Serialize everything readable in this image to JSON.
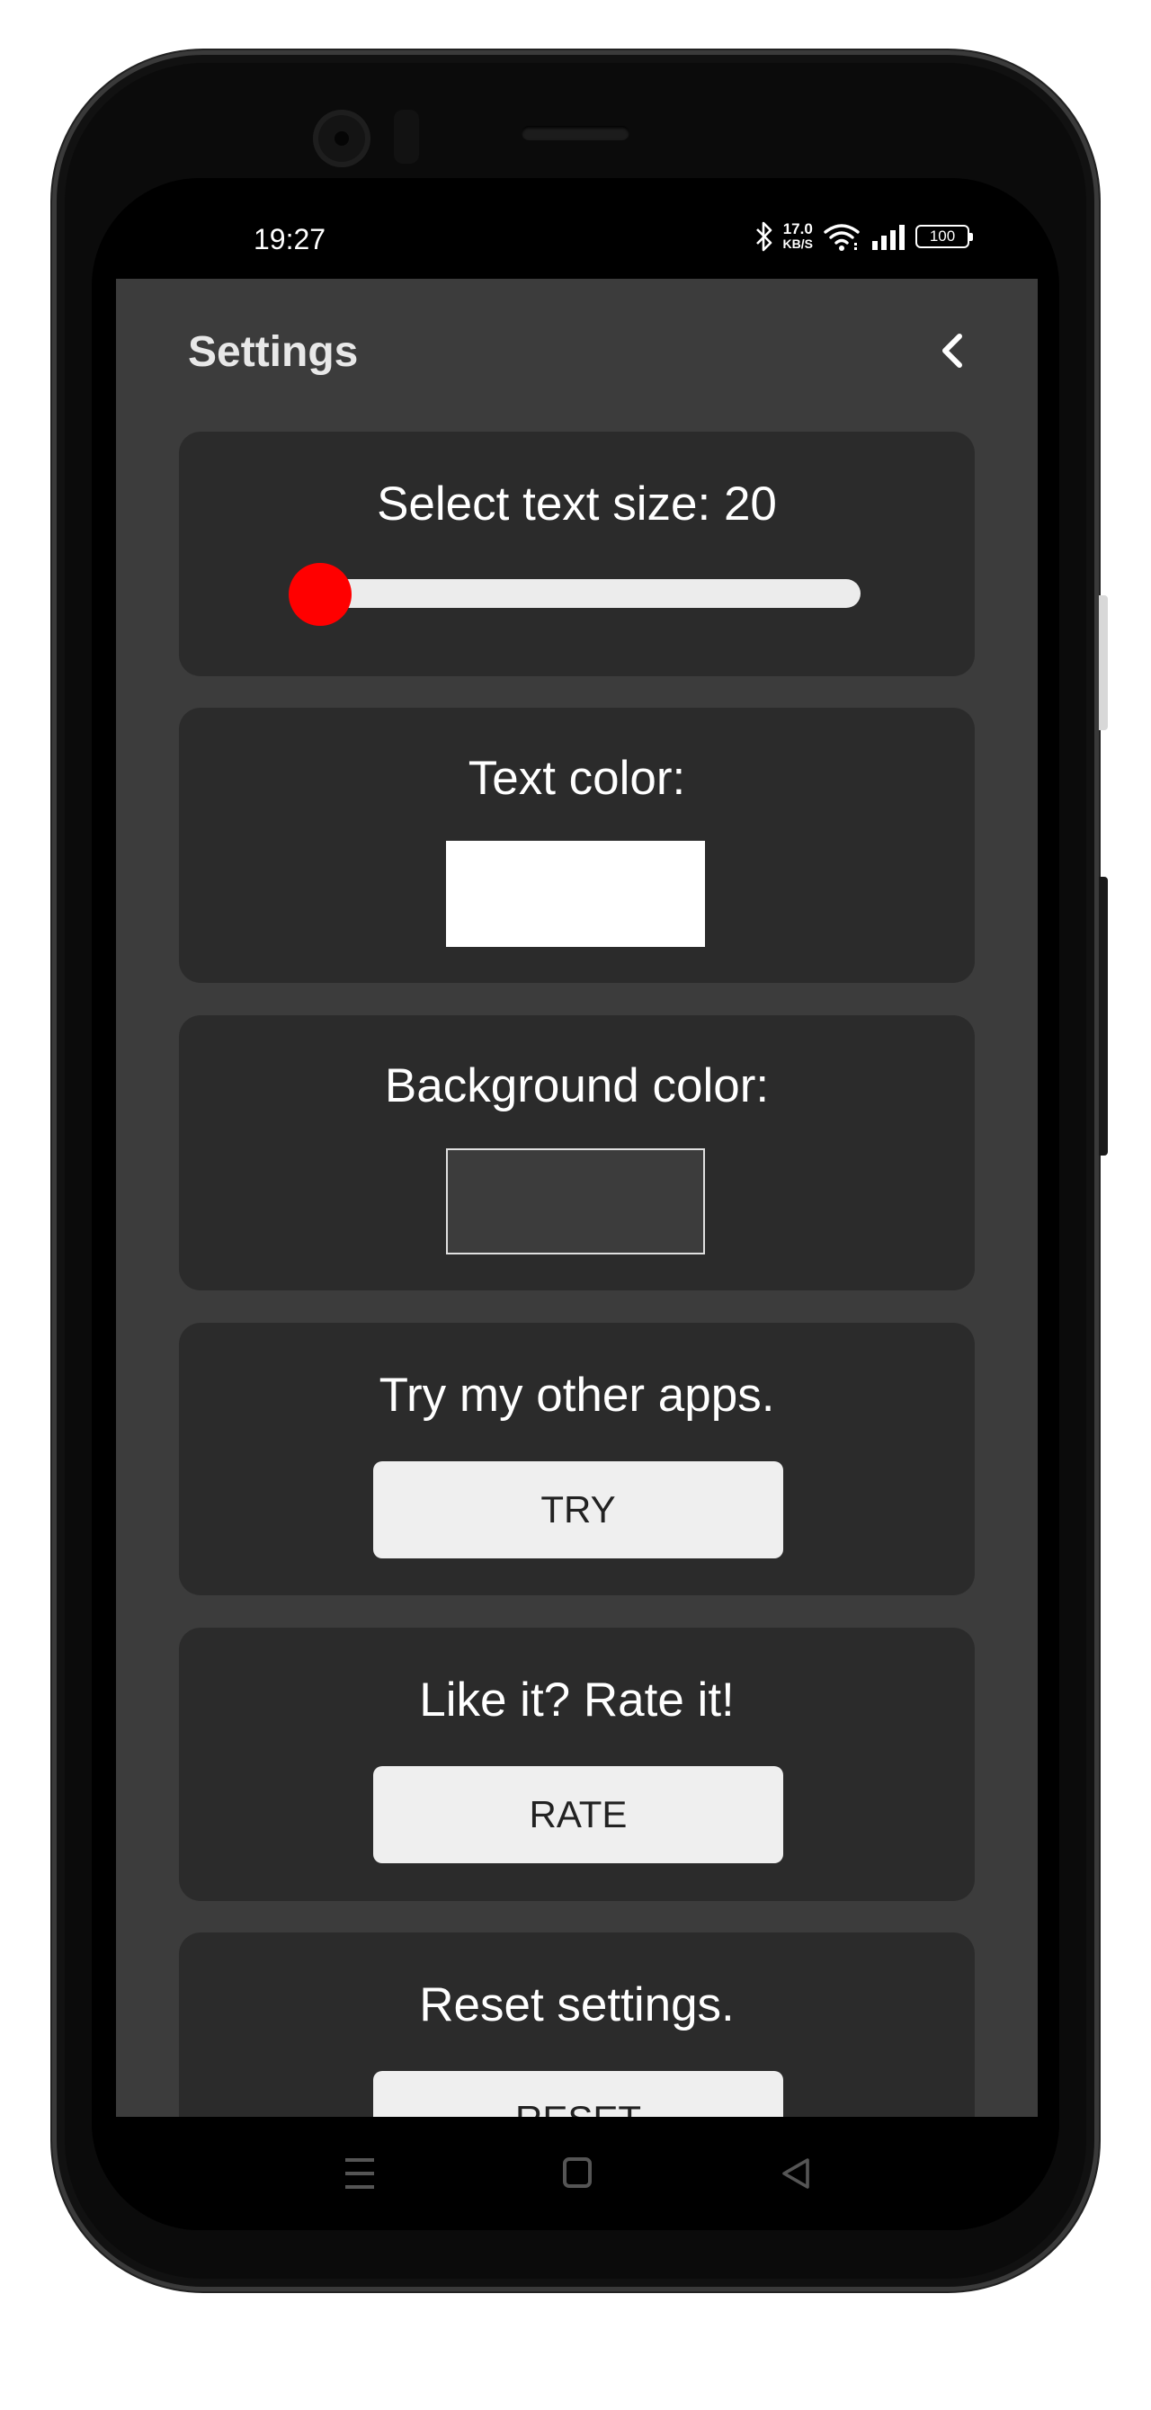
{
  "status_bar": {
    "time": "19:27",
    "network_speed_value": "17.0",
    "network_speed_unit": "KB/S",
    "battery": "100",
    "icons": [
      "bluetooth-icon",
      "wifi-icon",
      "signal-icon",
      "battery-icon"
    ]
  },
  "header": {
    "title": "Settings",
    "back_icon": "chevron-left-icon"
  },
  "text_size": {
    "label": "Select text size: 20",
    "value": 20,
    "slider_fraction": 0.0
  },
  "text_color": {
    "label": "Text color:",
    "color": "#ffffff"
  },
  "background_color": {
    "label": "Background color:",
    "color": "#3c3c3c"
  },
  "other_apps": {
    "label": "Try my other apps.",
    "button": "TRY"
  },
  "rate": {
    "label": "Like it? Rate it!",
    "button": "RATE"
  },
  "reset": {
    "label": "Reset settings.",
    "button": "RESET"
  },
  "nav_bar": {
    "icons": [
      "menu-icon",
      "home-icon",
      "back-triangle-icon"
    ]
  },
  "colors": {
    "accent": "#ff0000",
    "app_background": "#3c3c3c",
    "card_background": "#2b2b2b",
    "button_background": "#efefef"
  }
}
